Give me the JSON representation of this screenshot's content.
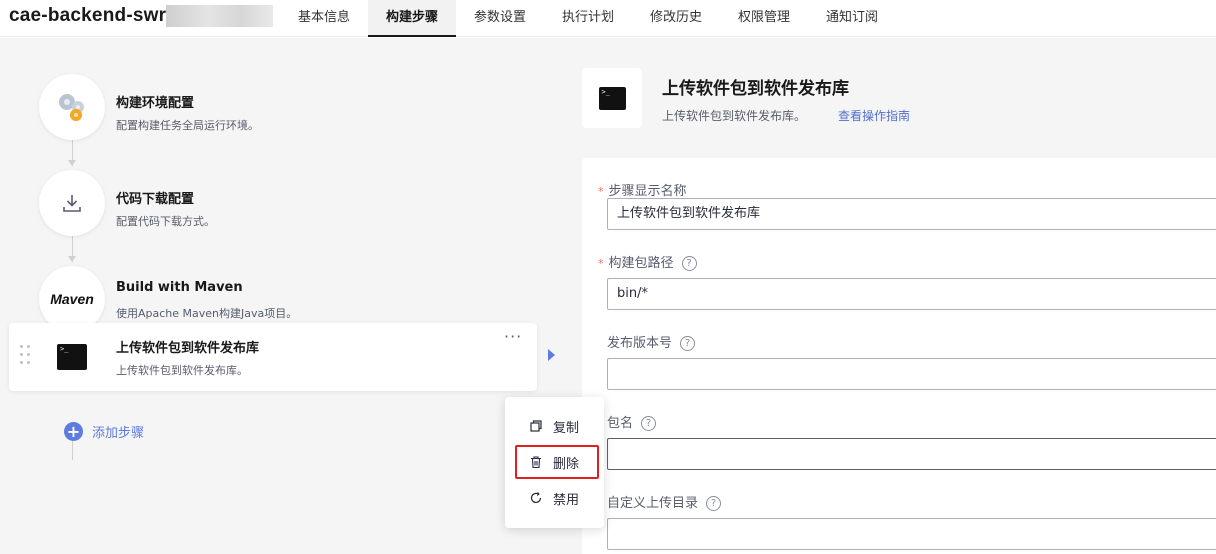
{
  "header": {
    "app_title": "cae-backend-swr",
    "tabs": [
      {
        "label": "基本信息",
        "active": false
      },
      {
        "label": "构建步骤",
        "active": true
      },
      {
        "label": "参数设置",
        "active": false
      },
      {
        "label": "执行计划",
        "active": false
      },
      {
        "label": "修改历史",
        "active": false
      },
      {
        "label": "权限管理",
        "active": false
      },
      {
        "label": "通知订阅",
        "active": false
      }
    ]
  },
  "steps": [
    {
      "title": "构建环境配置",
      "desc": "配置构建任务全局运行环境。",
      "icon": "gear-cluster-icon"
    },
    {
      "title": "代码下载配置",
      "desc": "配置代码下载方式。",
      "icon": "download-icon"
    },
    {
      "title": "Build with Maven",
      "desc": "使用Apache Maven构建Java项目。",
      "icon": "maven-logo",
      "logo_text": "Maven"
    },
    {
      "title": "上传软件包到软件发布库",
      "desc": "上传软件包到软件发布库。",
      "icon": "terminal-icon"
    }
  ],
  "add_step_label": "添加步骤",
  "context_menu": {
    "items": [
      {
        "label": "复制",
        "icon": "copy-icon"
      },
      {
        "label": "删除",
        "icon": "trash-icon"
      },
      {
        "label": "禁用",
        "icon": "disable-icon"
      }
    ]
  },
  "detail": {
    "title": "上传软件包到软件发布库",
    "desc": "上传软件包到软件发布库。",
    "guide_link": "查看操作指南",
    "fields": [
      {
        "label": "步骤显示名称",
        "required": true,
        "help": false,
        "value": "上传软件包到软件发布库"
      },
      {
        "label": "构建包路径",
        "required": true,
        "help": true,
        "value": "bin/*"
      },
      {
        "label": "发布版本号",
        "required": false,
        "help": true,
        "value": ""
      },
      {
        "label": "包名",
        "required": false,
        "help": true,
        "value": ""
      },
      {
        "label": "自定义上传目录",
        "required": false,
        "help": true,
        "value": ""
      }
    ]
  },
  "colors": {
    "accent": "#5e7ce0",
    "link": "#526ecc",
    "highlight": "#e02020",
    "panel_bg": "#f5f5f5"
  }
}
